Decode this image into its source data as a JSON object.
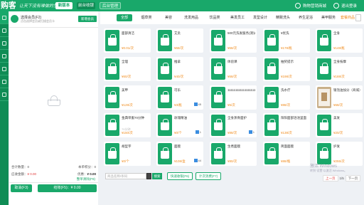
{
  "topbar": {
    "logo": "购客",
    "slogan": "让天下没有难做的生意",
    "new_button": "新版本",
    "cashier_tab": "前台收银",
    "backend_tab": "后台管理",
    "store_name": "购物营销商城",
    "logout": "退出登录"
  },
  "cart": {
    "member_title": "选择会员(F2)",
    "member_sub": "点击选择会员或扫描会员卡",
    "member_btn": "新增会员",
    "clear_link": "整单清除(F8)",
    "qty_label": "合计数量：",
    "qty_value": "0",
    "points_label": "本单积分：",
    "points_value": "0",
    "total_label": "应收金额：",
    "total_value": "¥ 0.00",
    "discount_label": "优惠：",
    "discount_value": "¥ 0.00",
    "cancel_label": "取消(F3)",
    "pay_label": "结账(F5)：¥ 0.00"
  },
  "tabs": [
    {
      "label": "全部",
      "active": true
    },
    {
      "label": "烟草类"
    },
    {
      "label": "美容"
    },
    {
      "label": "洗发用品"
    },
    {
      "label": "饮品类"
    },
    {
      "label": "美发员工"
    },
    {
      "label": "发型设计"
    },
    {
      "label": "精致洗头"
    },
    {
      "label": "养生足浴"
    },
    {
      "label": "美甲服务"
    },
    {
      "label": "套餐商品",
      "orange": true
    }
  ],
  "products": [
    {
      "name": "面部清洁",
      "price": "¥0.01/次"
    },
    {
      "name": "艾灸",
      "price": "¥68/次"
    },
    {
      "name": "500元洗发服务(测试用)",
      "price": "¥68/次"
    },
    {
      "name": "¥优洗",
      "price": "¥178/瓶"
    },
    {
      "name": "全身",
      "price": "¥148/瓶"
    },
    {
      "name": "全理",
      "price": "¥60/次"
    },
    {
      "name": "推拿",
      "price": "¥40/次"
    },
    {
      "name": "体验课",
      "price": "¥68/次"
    },
    {
      "name": "抽奖提示",
      "price": "¥198/次"
    },
    {
      "name": "全身按摩",
      "price": "¥188/次"
    },
    {
      "name": "美甲",
      "price": "¥128/次"
    },
    {
      "name": "可乐",
      "price": "¥3/瓶",
      "badge": "45"
    },
    {
      "name": "111111111111111111",
      "price": "¥5/次"
    },
    {
      "name": "洗水疗",
      "price": "¥88/次"
    },
    {
      "name": "银泡油加分（商城）",
      "price": "¥68/次",
      "photo": true
    },
    {
      "name": "金典单服70分钟",
      "stock": "70分钟",
      "price": "¥150/次"
    },
    {
      "name": "玫瑰精油",
      "price": "¥0/个",
      "badge": "1"
    },
    {
      "name": "全身蒸骨面护",
      "price": "¥88/次",
      "badge": "1"
    },
    {
      "name": "阳阳面部浴池里面",
      "price": "¥138/次"
    },
    {
      "name": "美发",
      "price": "¥20/次"
    },
    {
      "name": "胡型字",
      "price": "¥0/个"
    },
    {
      "name": "面膜",
      "price": "¥108/盒",
      "badge": "44"
    },
    {
      "name": "生煮面膜",
      "price": "¥80/次"
    },
    {
      "name": "简面面膜",
      "price": "¥88/瓶"
    },
    {
      "name": "护发",
      "price": "¥255/次"
    }
  ],
  "bottom": {
    "search_placeholder": "商品名称/条码",
    "search_btn": "搜索",
    "btn_hand_input": "快速收银(F6)",
    "btn_count_card": "计次消费(F7)",
    "watermark_line1": "激活 Windows",
    "watermark_line2": "转到“设置”以激活 Windows。",
    "pager_prev": "上一页",
    "pager_info": "1/5",
    "pager_next": "下一页"
  }
}
